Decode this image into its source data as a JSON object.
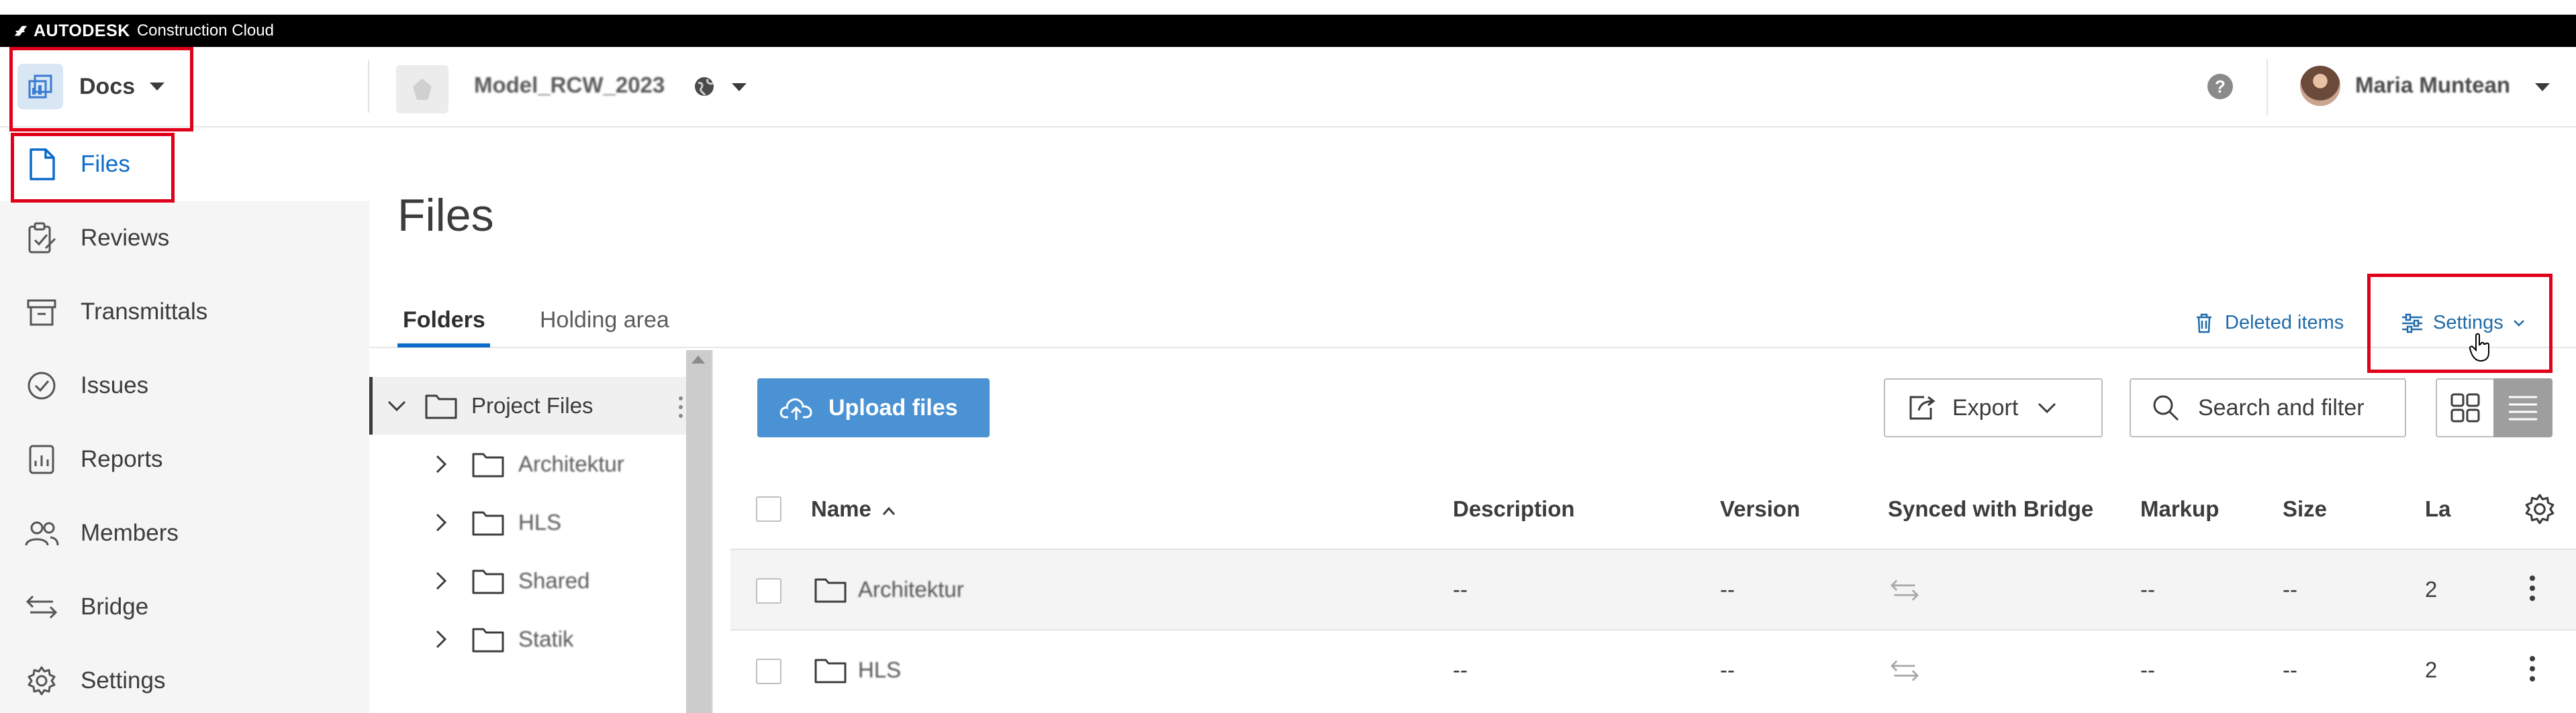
{
  "brand": {
    "name": "AUTODESK",
    "product": "Construction Cloud"
  },
  "header": {
    "module": "Docs",
    "project_name": "Model_RCW_2023",
    "help_label": "?",
    "user_name": "Maria Muntean"
  },
  "sidebar": {
    "items": [
      {
        "label": "Files",
        "icon": "file-icon"
      },
      {
        "label": "Reviews",
        "icon": "reviews-icon"
      },
      {
        "label": "Transmittals",
        "icon": "transmittals-icon"
      },
      {
        "label": "Issues",
        "icon": "issues-icon"
      },
      {
        "label": "Reports",
        "icon": "reports-icon"
      },
      {
        "label": "Members",
        "icon": "members-icon"
      },
      {
        "label": "Bridge",
        "icon": "bridge-icon"
      },
      {
        "label": "Settings",
        "icon": "gear-icon"
      }
    ]
  },
  "main": {
    "title": "Files",
    "tabs": [
      {
        "label": "Folders"
      },
      {
        "label": "Holding area"
      }
    ],
    "deleted_items": "Deleted items",
    "settings": "Settings"
  },
  "tree": {
    "root": "Project Files",
    "children": [
      "Architektur",
      "HLS",
      "Shared",
      "Statik"
    ]
  },
  "toolbar": {
    "upload": "Upload files",
    "export": "Export",
    "search": "Search and filter"
  },
  "table": {
    "columns": [
      "Name",
      "Description",
      "Version",
      "Synced with Bridge",
      "Markup",
      "Size",
      "La"
    ],
    "rows": [
      {
        "name": "Architektur",
        "description": "--",
        "version": "--",
        "markup": "--",
        "size": "--",
        "last": "2"
      },
      {
        "name": "HLS",
        "description": "--",
        "version": "--",
        "markup": "--",
        "size": "--",
        "last": "2"
      }
    ]
  },
  "colors": {
    "accent": "#0b6bcb",
    "upload": "#4b92d4",
    "highlight": "#e0001a"
  }
}
